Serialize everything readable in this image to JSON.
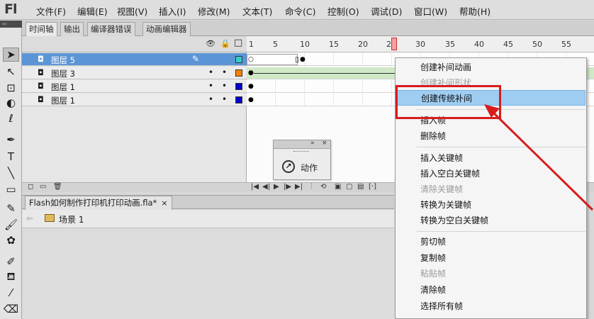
{
  "app": {
    "logo": "Fl"
  },
  "menu": [
    "文件(F)",
    "编辑(E)",
    "视图(V)",
    "插入(I)",
    "修改(M)",
    "文本(T)",
    "命令(C)",
    "控制(O)",
    "调试(D)",
    "窗口(W)",
    "帮助(H)"
  ],
  "toolbar": {
    "collapse": "‹‹"
  },
  "panel_tabs": [
    "时间轴",
    "输出",
    "编译器错误",
    "动画编辑器"
  ],
  "layers": [
    {
      "name": "图层 5",
      "color": "#33cccc",
      "selected": true
    },
    {
      "name": "图层 3",
      "color": "#ff8000",
      "selected": false
    },
    {
      "name": "图层 1",
      "color": "#0000cc",
      "selected": false
    },
    {
      "name": "图层 1",
      "color": "#0000cc",
      "selected": false
    }
  ],
  "timeline": {
    "ticks": [
      "1",
      "5",
      "10",
      "15",
      "20",
      "25",
      "30",
      "35",
      "40",
      "45",
      "50",
      "55"
    ],
    "current_frame": 25
  },
  "action_panel": {
    "label": "动作"
  },
  "document": {
    "tab_title": "Flash如何制作打印机打印动画.fla*",
    "close": "×"
  },
  "scene": {
    "label": "场景 1"
  },
  "context_menu": {
    "items": [
      {
        "label": "创建补间动画",
        "disabled": false
      },
      {
        "label": "创建补间形状",
        "disabled": true
      },
      {
        "label": "创建传统补间",
        "disabled": false,
        "highlighted": true
      },
      {
        "label": "插入帧",
        "disabled": false
      },
      {
        "label": "删除帧",
        "disabled": false
      },
      {
        "label": "插入关键帧",
        "disabled": false
      },
      {
        "label": "插入空白关键帧",
        "disabled": false
      },
      {
        "label": "清除关键帧",
        "disabled": true
      },
      {
        "label": "转换为关键帧",
        "disabled": false
      },
      {
        "label": "转换为空白关键帧",
        "disabled": false
      },
      {
        "label": "剪切帧",
        "disabled": false
      },
      {
        "label": "复制帧",
        "disabled": false
      },
      {
        "label": "粘贴帧",
        "disabled": true
      },
      {
        "label": "清除帧",
        "disabled": false
      },
      {
        "label": "选择所有帧",
        "disabled": false
      }
    ]
  },
  "colors": {
    "accent_red": "#d81c1c",
    "selection_blue": "#5b95d6",
    "menu_highlight": "#9fcdf2",
    "tween_green": "#cfe9c6"
  }
}
